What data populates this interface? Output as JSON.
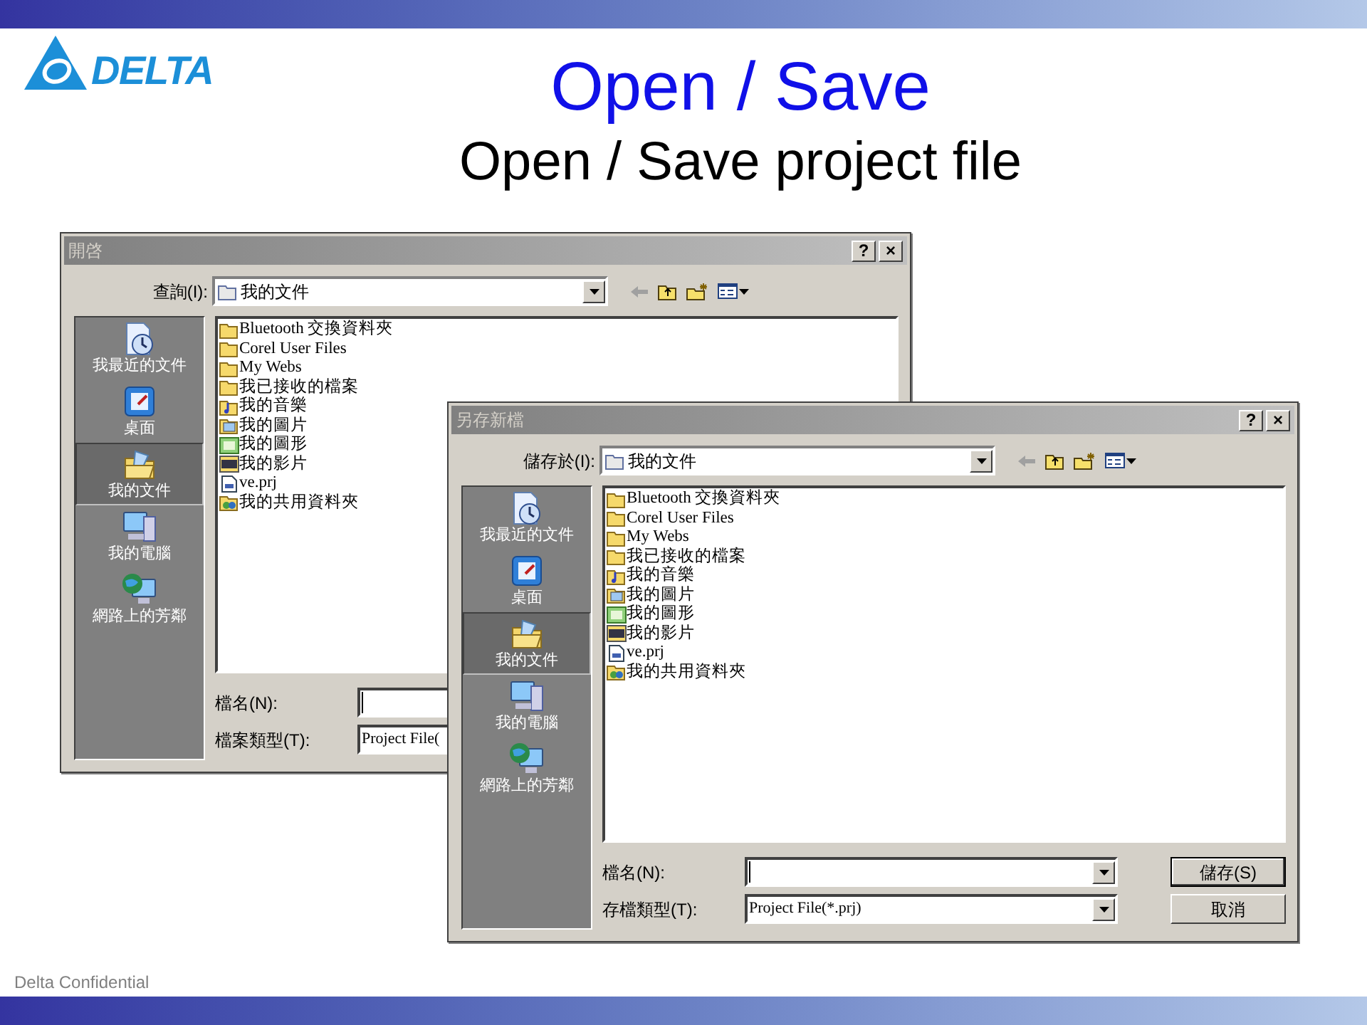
{
  "logo": {
    "text": "DELTA"
  },
  "title": "Open / Save",
  "subtitle": "Open / Save project file",
  "dialogs": [
    {
      "title": "開啓",
      "title_buttons": [
        "?",
        "×"
      ],
      "location_label": "查詢(I):",
      "location_value": "我的文件",
      "places": [
        {
          "kind": "recent",
          "label": "我最近的文件",
          "selected": false
        },
        {
          "kind": "desktop",
          "label": "桌面",
          "selected": false
        },
        {
          "kind": "documents",
          "label": "我的文件",
          "selected": true
        },
        {
          "kind": "computer",
          "label": "我的電腦",
          "selected": false
        },
        {
          "kind": "network",
          "label": "網路上的芳鄰",
          "selected": false
        }
      ],
      "files": [
        {
          "kind": "folder",
          "name": "Bluetooth 交換資料夾"
        },
        {
          "kind": "folder",
          "name": "Corel User Files"
        },
        {
          "kind": "folder",
          "name": "My Webs"
        },
        {
          "kind": "folder",
          "name": "我已接收的檔案"
        },
        {
          "kind": "music",
          "name": "我的音樂"
        },
        {
          "kind": "pictures",
          "name": "我的圖片"
        },
        {
          "kind": "images",
          "name": "我的圖形"
        },
        {
          "kind": "video",
          "name": "我的影片"
        },
        {
          "kind": "project",
          "name": "ve.prj"
        },
        {
          "kind": "shared",
          "name": "我的共用資料夾"
        }
      ],
      "fields": [
        {
          "label": "檔名(N):"
        },
        {
          "label": "檔案類型(T):",
          "value": "Project File("
        }
      ]
    },
    {
      "title": "另存新檔",
      "title_buttons": [
        "?",
        "×"
      ],
      "location_label": "儲存於(I):",
      "location_value": "我的文件",
      "places": [
        {
          "kind": "recent",
          "label": "我最近的文件",
          "selected": false
        },
        {
          "kind": "desktop",
          "label": "桌面",
          "selected": false
        },
        {
          "kind": "documents",
          "label": "我的文件",
          "selected": true
        },
        {
          "kind": "computer",
          "label": "我的電腦",
          "selected": false
        },
        {
          "kind": "network",
          "label": "網路上的芳鄰",
          "selected": false
        }
      ],
      "files": [
        {
          "kind": "folder",
          "name": "Bluetooth 交換資料夾"
        },
        {
          "kind": "folder",
          "name": "Corel User Files"
        },
        {
          "kind": "folder",
          "name": "My Webs"
        },
        {
          "kind": "folder",
          "name": "我已接收的檔案"
        },
        {
          "kind": "music",
          "name": "我的音樂"
        },
        {
          "kind": "pictures",
          "name": "我的圖片"
        },
        {
          "kind": "images",
          "name": "我的圖形"
        },
        {
          "kind": "video",
          "name": "我的影片"
        },
        {
          "kind": "project",
          "name": "ve.prj"
        },
        {
          "kind": "shared",
          "name": "我的共用資料夾"
        }
      ],
      "fields": [
        {
          "label": "檔名(N):"
        },
        {
          "label": "存檔類型(T):",
          "value": "Project File(*.prj)"
        }
      ],
      "buttons": [
        "儲存(S)",
        "取消"
      ]
    }
  ],
  "footer": "Delta Confidential"
}
